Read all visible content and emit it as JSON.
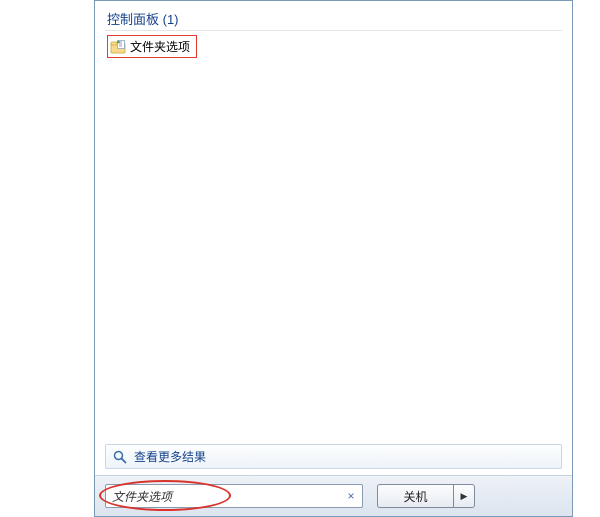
{
  "category": {
    "label": "控制面板 (1)"
  },
  "results": [
    {
      "icon": "folder-options-icon",
      "label": "文件夹选项"
    }
  ],
  "moreResults": {
    "icon": "search-icon",
    "label": "查看更多结果"
  },
  "search": {
    "value": "文件夹选项",
    "clear": "×"
  },
  "shutdown": {
    "label": "关机",
    "arrow": "▶"
  }
}
